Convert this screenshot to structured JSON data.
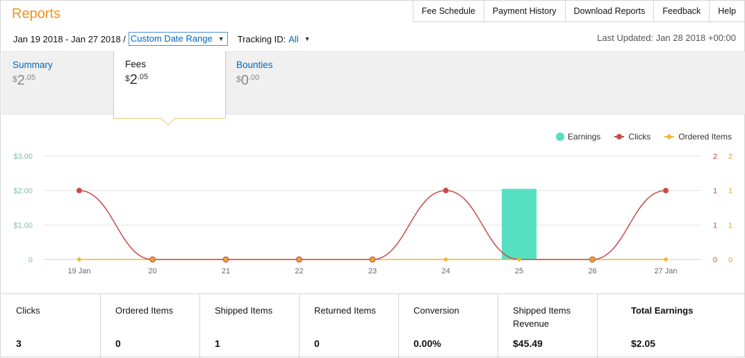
{
  "header": {
    "title": "Reports",
    "nav": [
      "Fee Schedule",
      "Payment History",
      "Download Reports",
      "Feedback",
      "Help"
    ],
    "date_range": "Jan 19 2018 - Jan 27 2018 /",
    "date_range_select": "Custom Date Range",
    "tracking_label": "Tracking ID:",
    "tracking_value": "All",
    "last_updated": "Last Updated: Jan 28 2018 +00:00"
  },
  "tabs": [
    {
      "label": "Summary",
      "currency": "$",
      "whole": "2",
      "frac": ".05"
    },
    {
      "label": "Fees",
      "currency": "$",
      "whole": "2",
      "frac": ".05"
    },
    {
      "label": "Bounties",
      "currency": "$",
      "whole": "0",
      "frac": ".00"
    }
  ],
  "legend": {
    "earnings": "Earnings",
    "clicks": "Clicks",
    "ordered": "Ordered Items"
  },
  "colors": {
    "earnings": "#55e0c2",
    "clicks": "#c94a4a",
    "ordered": "#f2b431",
    "accent": "#f0941c",
    "link": "#0066c0"
  },
  "chart_data": {
    "type": "bar",
    "categories": [
      "19 Jan",
      "20",
      "21",
      "22",
      "23",
      "24",
      "25",
      "26",
      "27 Jan"
    ],
    "series": [
      {
        "name": "Earnings",
        "type": "bar",
        "axis": "left",
        "values": [
          0,
          0,
          0,
          0,
          0,
          0,
          2.05,
          0,
          0
        ]
      },
      {
        "name": "Clicks",
        "type": "line",
        "axis": "right",
        "values": [
          1,
          0,
          0,
          0,
          0,
          1,
          0,
          0,
          1
        ]
      },
      {
        "name": "Ordered Items",
        "type": "line",
        "axis": "right",
        "values": [
          0,
          0,
          0,
          0,
          0,
          0,
          0,
          0,
          0
        ]
      }
    ],
    "left_ticks": [
      "0",
      "$1.00",
      "$2.00",
      "$3.00"
    ],
    "right_ticks_clicks": [
      "0",
      "1",
      "1",
      "2"
    ],
    "right_ticks_ordered": [
      "0",
      "1",
      "1",
      "2"
    ],
    "ylim_left": [
      0,
      3
    ],
    "ylim_right": [
      0,
      1.5
    ],
    "grid": true,
    "legend_position": "top-right"
  },
  "stats": [
    {
      "label": "Clicks",
      "value": "3"
    },
    {
      "label": "Ordered Items",
      "value": "0"
    },
    {
      "label": "Shipped Items",
      "value": "1"
    },
    {
      "label": "Returned Items",
      "value": "0"
    },
    {
      "label": "Conversion",
      "value": "0.00%"
    },
    {
      "label": "Shipped Items Revenue",
      "value": "$45.49"
    },
    {
      "label": "Total Earnings",
      "value": "$2.05"
    }
  ]
}
